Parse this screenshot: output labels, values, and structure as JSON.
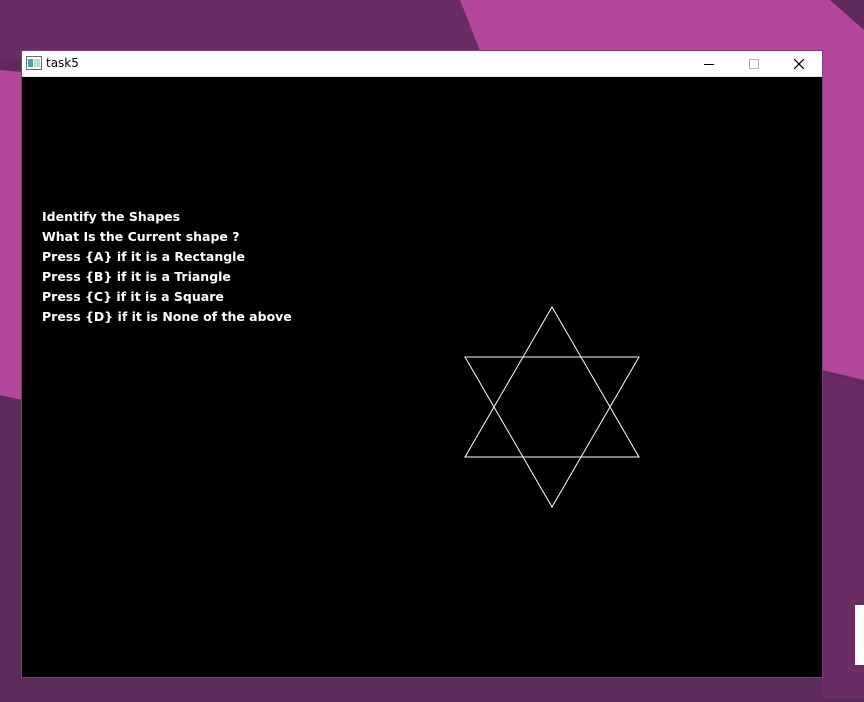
{
  "window": {
    "title": "task5",
    "controls": {
      "minimize_icon": "minimize-icon",
      "maximize_icon": "maximize-icon",
      "close_icon": "close-icon"
    }
  },
  "content": {
    "lines": [
      "Identify the Shapes",
      "What Is the Current shape ?",
      "Press {A} if it is a Rectangle",
      "Press {B} if it is a Triangle",
      "Press {C} if it is a Square",
      "Press {D} if it is None of the above"
    ],
    "shape": "six-pointed-star",
    "colors": {
      "background": "#000000",
      "text": "#ffffff",
      "stroke": "#ffffff"
    }
  },
  "desktop": {
    "colors": {
      "base": "#5d2a5a",
      "accent": "#b2479b"
    }
  }
}
